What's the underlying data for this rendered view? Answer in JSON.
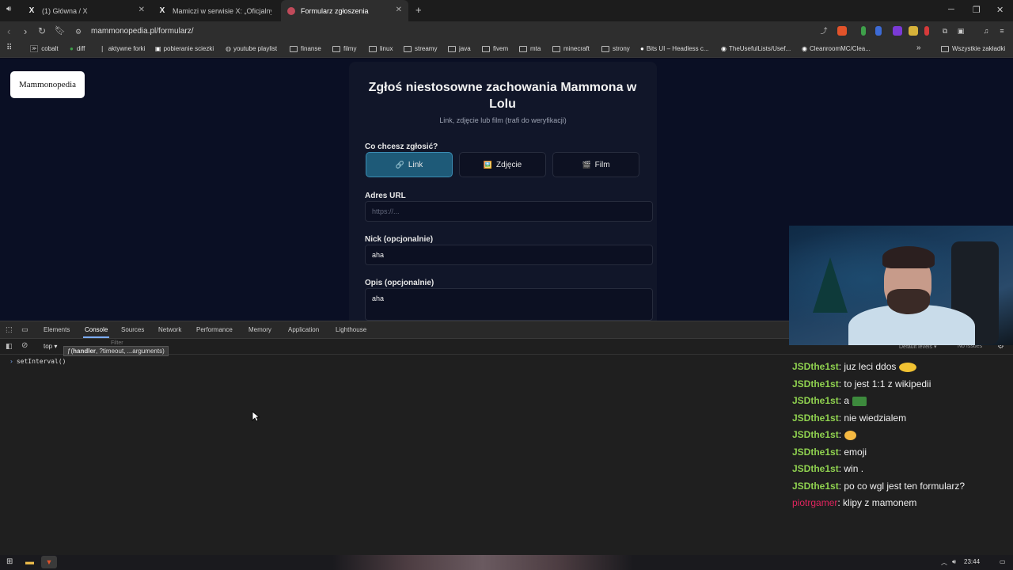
{
  "browser": {
    "tabs": [
      {
        "title": "(1) Główna / X",
        "icon": "x-logo"
      },
      {
        "title": "Mamiczi w serwisie X: „Oficjalny link ...",
        "icon": "x-logo"
      },
      {
        "title": "Formularz zgłoszenia",
        "icon": "site-icon",
        "active": true
      }
    ],
    "new_tab_label": "+",
    "url": "mammonopedia.pl/formularz/",
    "bookmarks": [
      "cobalt",
      "diff",
      "aktywne forki",
      "pobieranie sciezki",
      "youtube playlist",
      "finanse",
      "filmy",
      "linux",
      "streamy",
      "java",
      "fivem",
      "mta",
      "minecraft",
      "strony",
      "Bits UI – Headless c...",
      "TheUsefulLists/Usef...",
      "CleanroomMC/Clea..."
    ],
    "all_bookmarks_label": "Wszystkie zakładki"
  },
  "page": {
    "logo_text": "Mammonopedia",
    "form": {
      "title": "Zgłoś niestosowne zachowania Mammona w Lolu",
      "subtitle": "Link, zdjęcie lub film (trafi do weryfikacji)",
      "question_label": "Co chcesz zgłosić?",
      "type_buttons": [
        {
          "label": "Link",
          "icon": "🔗",
          "selected": true
        },
        {
          "label": "Zdjęcie",
          "icon": "🖼️",
          "selected": false
        },
        {
          "label": "Film",
          "icon": "🎬",
          "selected": false
        }
      ],
      "url_label": "Adres URL",
      "url_placeholder": "https://...",
      "nick_label": "Nick (opcjonalnie)",
      "nick_value": "aha",
      "desc_label": "Opis (opcjonalnie)",
      "desc_value": "aha"
    }
  },
  "devtools": {
    "tabs": [
      "Elements",
      "Console",
      "Sources",
      "Network",
      "Performance",
      "Memory",
      "Application",
      "Lighthouse"
    ],
    "active_tab": "Console",
    "context": "top",
    "filter_placeholder": "Filter",
    "levels": "Default levels",
    "issues": "No Issues",
    "tooltip": "ƒ(handler, ?timeout, ...arguments)",
    "tooltip_bold": "handler",
    "console_input": "setInterval()"
  },
  "chat": [
    {
      "user": "JSDthe1st",
      "message": "juz leci ddos",
      "color": "#8fd14f",
      "emote": "#f1c232"
    },
    {
      "user": "JSDthe1st",
      "message": "to jest 1:1 z wikipedii",
      "color": "#8fd14f"
    },
    {
      "user": "JSDthe1st",
      "message": "a",
      "color": "#8fd14f",
      "emote": "#3d8a3d"
    },
    {
      "user": "JSDthe1st",
      "message": "nie wiedzialem",
      "color": "#8fd14f"
    },
    {
      "user": "JSDthe1st",
      "message": "",
      "color": "#8fd14f",
      "emote": "#f5b942"
    },
    {
      "user": "JSDthe1st",
      "message": "emoji",
      "color": "#8fd14f"
    },
    {
      "user": "JSDthe1st",
      "message": "win .",
      "color": "#8fd14f"
    },
    {
      "user": "JSDthe1st",
      "message": "po co wgl jest ten formularz?",
      "color": "#8fd14f"
    },
    {
      "user": "piotrgamer",
      "message": "klipy z mamonem",
      "color": "#e0245e"
    }
  ],
  "taskbar": {
    "clock": "23:44"
  }
}
